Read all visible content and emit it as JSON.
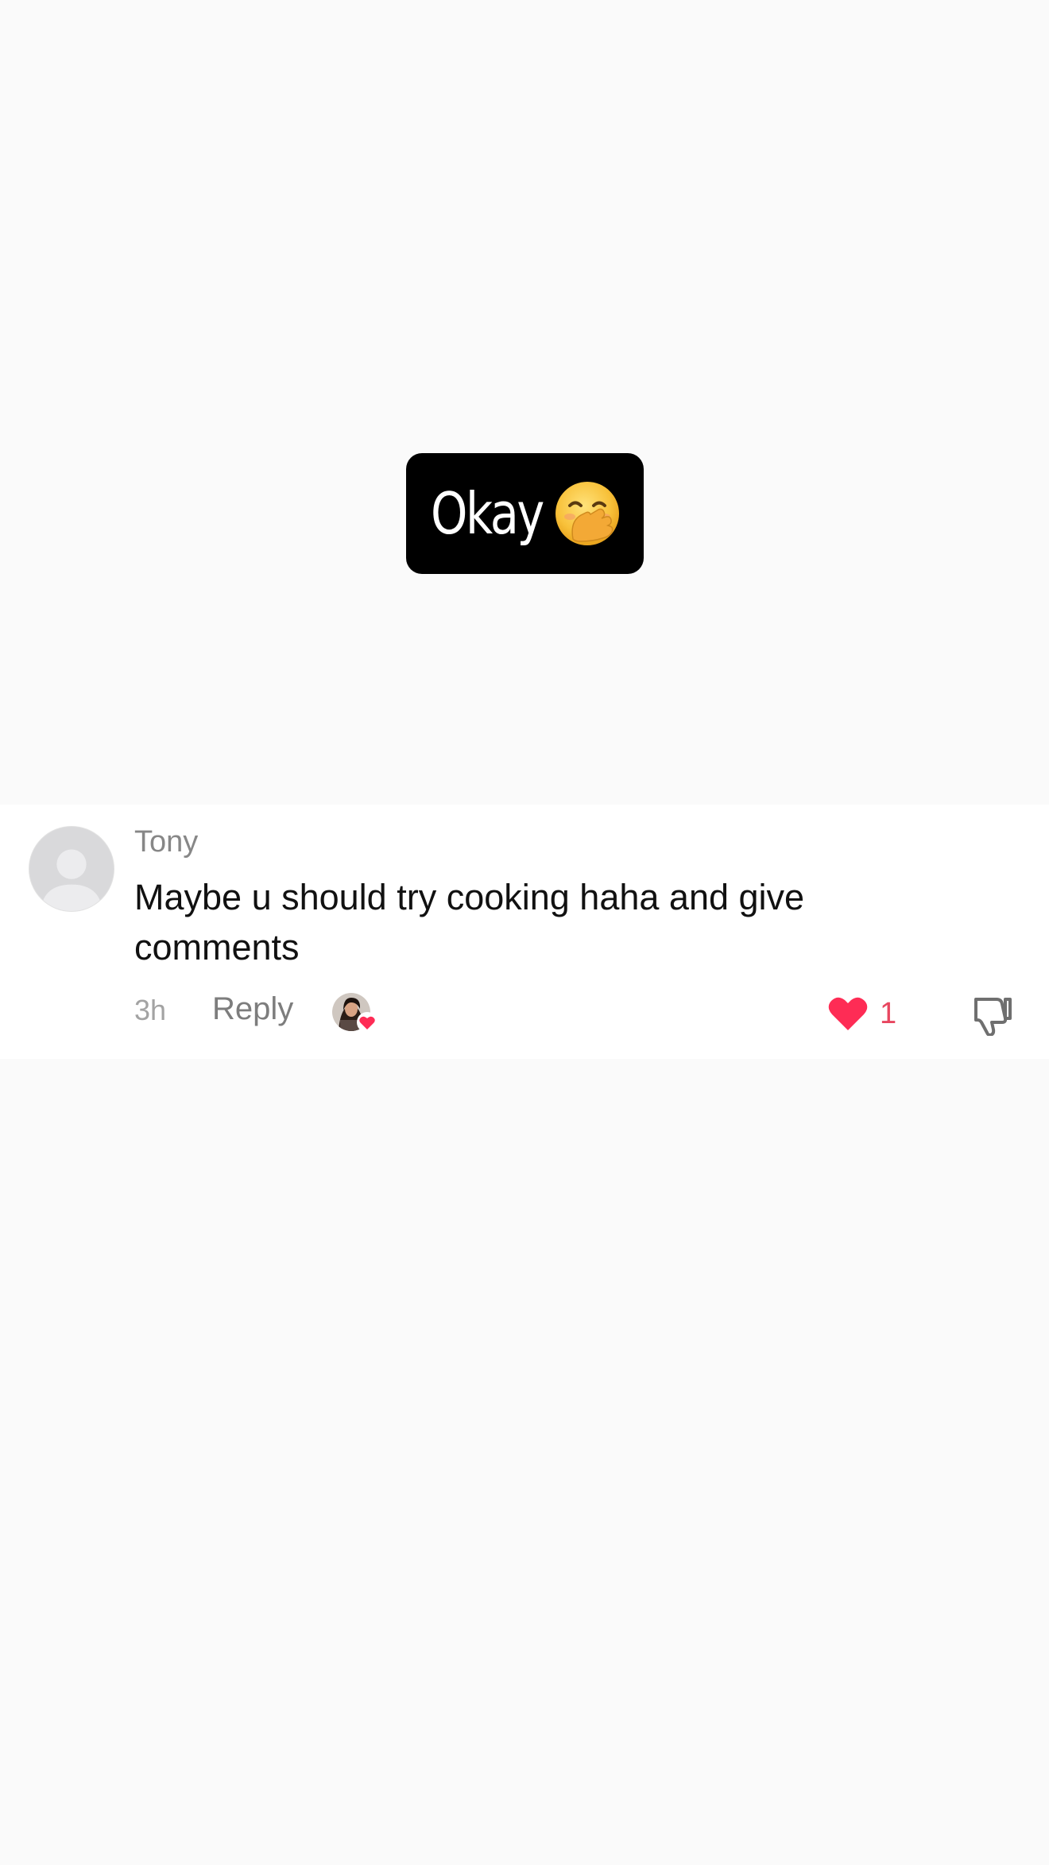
{
  "video_overlay": {
    "text": "Okay",
    "emoji_icon": "hand-over-mouth-emoji-icon"
  },
  "comment": {
    "username": "Tony",
    "text": "Maybe u should try cooking haha and give comments",
    "time": "3h",
    "reply_label": "Reply",
    "like_count": "1",
    "liked_by_creator": true
  },
  "colors": {
    "like_red": "#fe2c55",
    "muted_gray": "#878787"
  }
}
